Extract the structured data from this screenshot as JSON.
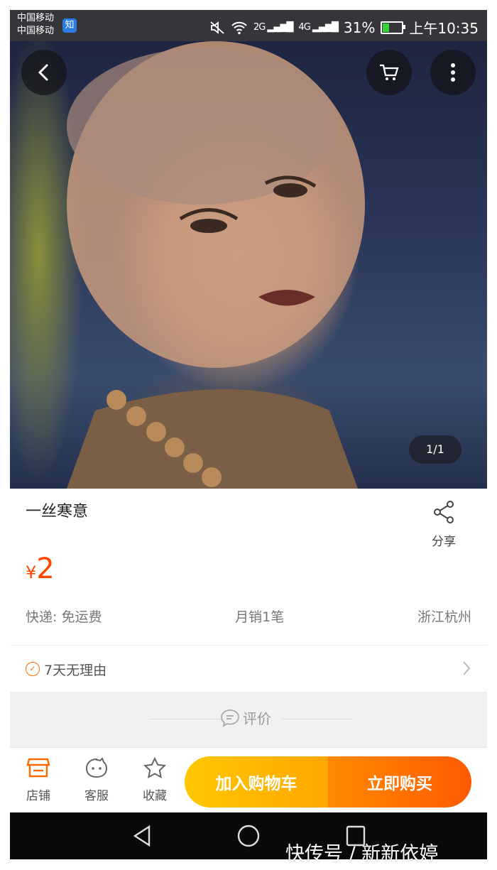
{
  "status_bar": {
    "carrier_1": "中国移动",
    "carrier_2": "中国移动",
    "zhi_badge": "知",
    "signal_1": "2G",
    "signal_2": "4G",
    "battery": "31%",
    "battery_level": 0.31,
    "time": "上午10:35"
  },
  "header": {
    "icons": [
      "back-icon",
      "cart-icon",
      "more-icon"
    ]
  },
  "gallery": {
    "page_indicator": "1/1"
  },
  "product": {
    "title": "一丝寒意",
    "share_label": "分享",
    "currency": "¥",
    "price": "2",
    "shipping": "快递: 免运费",
    "monthly_sales": "月销1笔",
    "location": "浙江杭州",
    "guarantee": "7天无理由"
  },
  "review": {
    "label": "评价"
  },
  "bottom_bar": {
    "store_label": "店铺",
    "service_label": "客服",
    "favorite_label": "收藏",
    "add_to_cart": "加入购物车",
    "buy_now": "立即购买"
  },
  "watermark": "快传号 / 新新依婷",
  "colors": {
    "accent": "#ff4400",
    "cart_gradient": [
      "#ffc700",
      "#ffa700"
    ],
    "buy_gradient": [
      "#ff8a00",
      "#ff5a00"
    ]
  }
}
